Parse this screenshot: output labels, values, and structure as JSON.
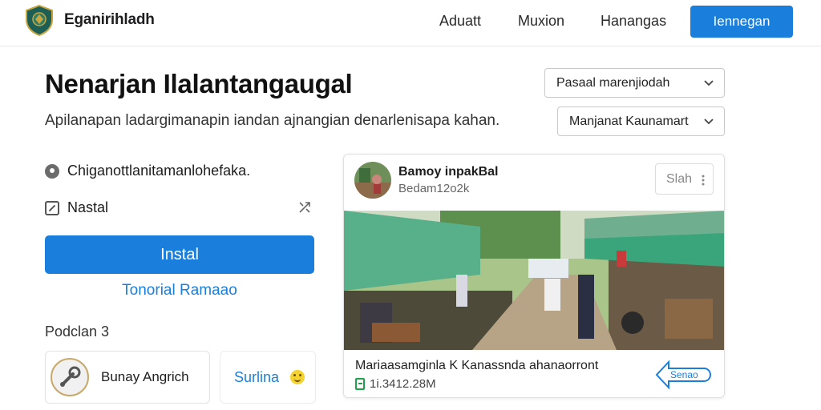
{
  "header": {
    "brand": "Eganirihladh",
    "nav": [
      "Aduatt",
      "Muxion",
      "Hanangas"
    ],
    "cta_label": "Iennegan"
  },
  "page": {
    "title": "Nenarjan Ilalantangaugal",
    "subtitle": "Apilanapan ladargimanapin iandan ajnangian denarlenisapa kahan.",
    "select_primary": "Pasaal marenjiodah",
    "select_secondary": "Manjanat Kaunamart"
  },
  "left": {
    "row1_text": "Chiganottlanitamanlohefaka.",
    "row2_text": "Nastal",
    "install_label": "Instal",
    "tutorial_link": "Tonorial Ramaao",
    "section_label": "Podclan 3",
    "mini_card_name": "Bunay Angrich",
    "mini_card2_text": "Surlina"
  },
  "post": {
    "author": "Bamoy inpakBal",
    "meta": "Bedam12o2k",
    "action_label": "Slah",
    "caption": "Mariaasamginla K Kanassnda ahanaorront",
    "date": "1i.3412.28M",
    "share_label": "Senao"
  },
  "colors": {
    "accent": "#1a7fdc",
    "text": "#1d1d1f",
    "border": "#e0e0e0",
    "success": "#1fa24a"
  }
}
